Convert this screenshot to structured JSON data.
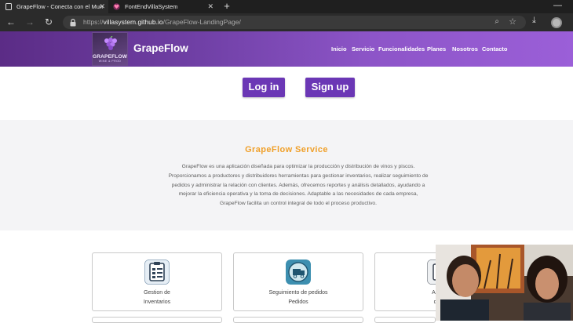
{
  "browser": {
    "tabs": [
      {
        "title": "GrapeFlow - Conecta con el Mun"
      },
      {
        "title": "FontEndVillaSystem"
      }
    ],
    "new_tab": "+",
    "url_host": "villasystem.github.io",
    "url_prefix": "https://",
    "url_path": "/GrapeFlow-LandingPage/"
  },
  "site": {
    "logo_text": "GRAPEFLOW",
    "logo_sub": "WINE & PROD",
    "brand": "GrapeFlow",
    "nav": [
      "Inicio",
      "Servicio",
      "Funcionalidades",
      "Planes",
      "Nosotros",
      "Contacto"
    ],
    "login": "Log in",
    "signup": "Sign up",
    "service_title": "GrapeFlow Service",
    "service_lines": [
      "GrapeFlow es una aplicación diseñada para optimizar la producción y distribución de vinos y piscos.",
      "Proporcionamos a productores y distribuidores herramientas para gestionar inventarios, realizar seguimiento de",
      "pedidos y administrar la relación con clientes. Además, ofrecemos reportes y análisis detallados, ayudando a",
      "mejorar la eficiencia operativa y la toma de decisiones. Adaptable a las necesidades de cada empresa,",
      "GrapeFlow facilita un control integral de todo el proceso productivo."
    ],
    "cards": [
      {
        "line1": "Gestion de",
        "line2": "Inventarios"
      },
      {
        "line1": "Seguimiento de pedidos",
        "line2": "Pedidos"
      },
      {
        "line1": "Admin",
        "line2": "de C"
      }
    ]
  },
  "colors": {
    "header_start": "#5b2c86",
    "header_end": "#9b5fd8",
    "button": "#6b37b5",
    "service_title": "#f0a02a"
  }
}
